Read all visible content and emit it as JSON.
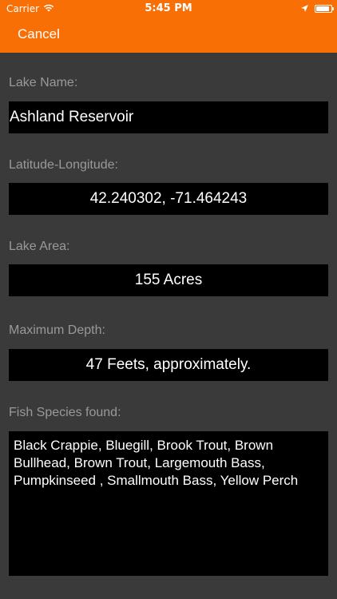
{
  "status_bar": {
    "carrier": "Carrier",
    "time": "5:45 PM",
    "icons": [
      "wifi-icon",
      "location-arrow-icon",
      "battery-icon"
    ],
    "battery_level": 0.9
  },
  "nav": {
    "cancel_label": "Cancel",
    "background_color": "#f86f06"
  },
  "form": {
    "lake_name_label": "Lake Name:",
    "lake_name_value": "Ashland Reservoir",
    "lat_long_label": "Latitude-Longitude:",
    "lat_long_value": "42.240302, -71.464243",
    "lake_area_label": "Lake Area:",
    "lake_area_value": "155 Acres",
    "max_depth_label": "Maximum Depth:",
    "max_depth_value": "47 Feets, approximately.",
    "fish_species_label": "Fish Species found:",
    "fish_species_value": "Black Crappie, Bluegill, Brook Trout, Brown Bullhead, Brown Trout, Largemouth Bass, Pumpkinseed , Smallmouth Bass, Yellow Perch"
  },
  "colors": {
    "background": "#3a3a3a",
    "field_background": "#000000",
    "label_text": "#999999"
  }
}
